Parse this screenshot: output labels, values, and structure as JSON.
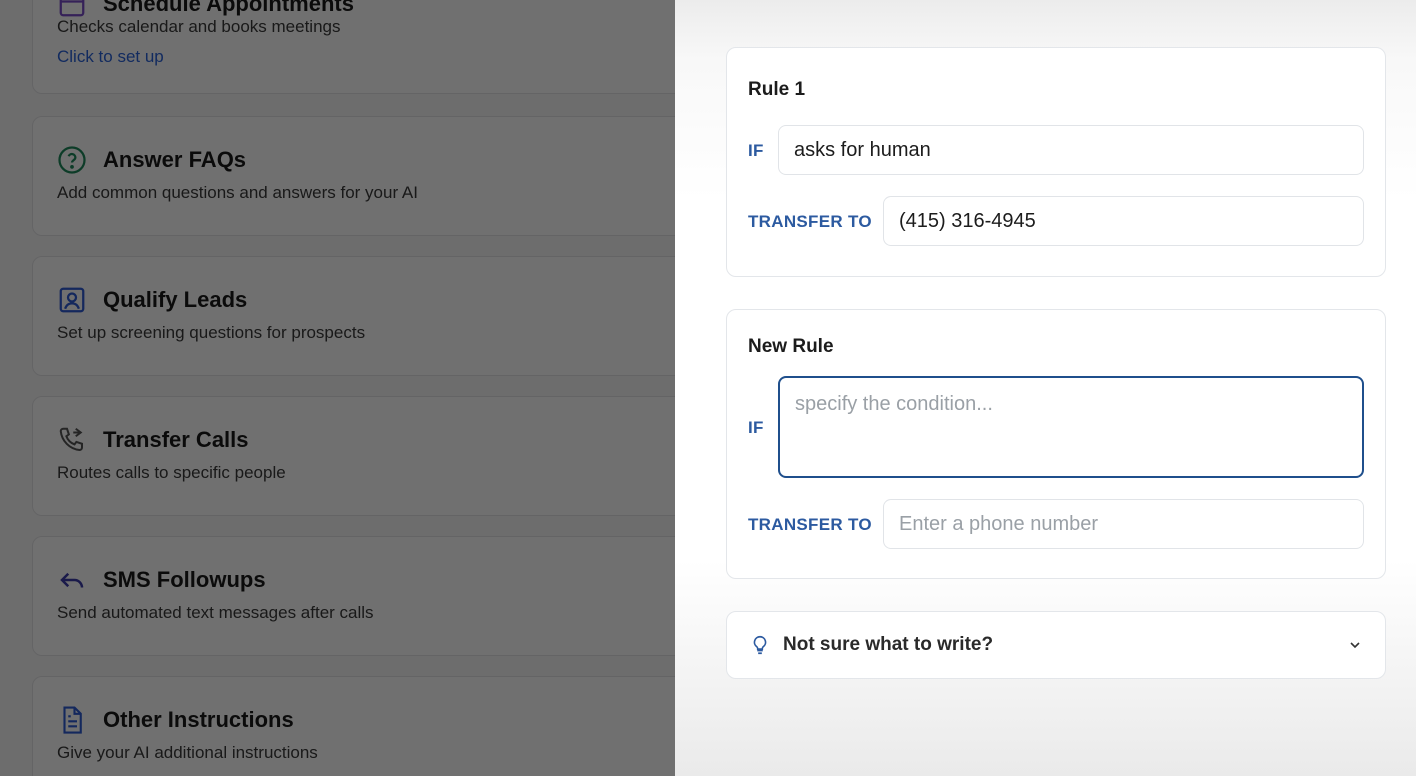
{
  "features": [
    {
      "id": "schedule",
      "title": "Schedule Appointments",
      "description": "Checks calendar and books meetings",
      "link": "Click to set up",
      "icon": "calendar-icon"
    },
    {
      "id": "faqs",
      "title": "Answer FAQs",
      "description": "Add common questions and answers for your AI",
      "icon": "question-circle-icon"
    },
    {
      "id": "leads",
      "title": "Qualify Leads",
      "description": "Set up screening questions for prospects",
      "icon": "user-badge-icon"
    },
    {
      "id": "transfer",
      "title": "Transfer Calls",
      "description": "Routes calls to specific people",
      "icon": "phone-forward-icon"
    },
    {
      "id": "sms",
      "title": "SMS Followups",
      "description": "Send automated text messages after calls",
      "icon": "reply-arrow-icon"
    },
    {
      "id": "other",
      "title": "Other Instructions",
      "description": "Give your AI additional instructions",
      "icon": "document-icon"
    }
  ],
  "rules": [
    {
      "title": "Rule 1",
      "if_label": "IF",
      "if_value": "asks for human",
      "transfer_label": "TRANSFER TO",
      "transfer_value": "(415) 316-4945"
    }
  ],
  "new_rule": {
    "title": "New Rule",
    "if_label": "IF",
    "if_placeholder": "specify the condition...",
    "transfer_label": "TRANSFER TO",
    "transfer_placeholder": "Enter a phone number"
  },
  "help": {
    "text": "Not sure what to write?",
    "icon": "lightbulb-icon",
    "toggle_icon": "chevron-down-icon"
  },
  "colors": {
    "accent": "#2c5aa0",
    "focus_border": "#1f4f8c",
    "link": "#2b62d9",
    "faq_icon": "#1f8a5b",
    "leads_icon": "#2f5bd3",
    "sms_icon": "#3c3ca8",
    "doc_icon": "#2f5bd3"
  }
}
